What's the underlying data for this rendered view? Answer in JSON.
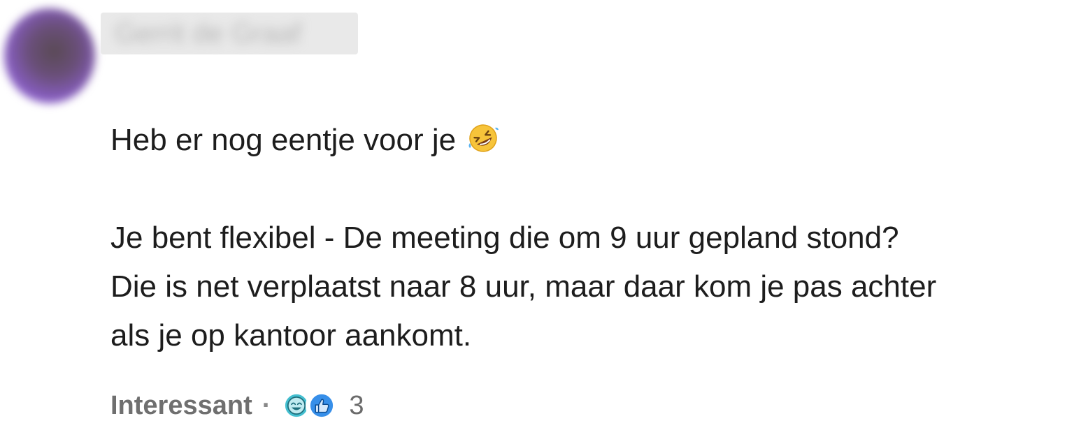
{
  "comment": {
    "author": {
      "name": "Gerrit de Graaf"
    },
    "text_line1": "Heb er nog eentje voor je",
    "text_line2": "Je bent flexibel - De meeting die om 9 uur gepland stond?",
    "text_line3": "Die is net verplaatst naar 8 uur, maar daar kom je pas achter",
    "text_line4": "als je op kantoor aankomt.",
    "inline_emoji": "rolling-on-the-floor-laughing-emoji"
  },
  "footer": {
    "action_label": "Interessant",
    "separator": "·",
    "reactions": [
      {
        "icon": "funny-reaction-icon",
        "color": "#44bfd0"
      },
      {
        "icon": "like-reaction-icon",
        "color": "#378fe9"
      }
    ],
    "reaction_count": "3"
  }
}
